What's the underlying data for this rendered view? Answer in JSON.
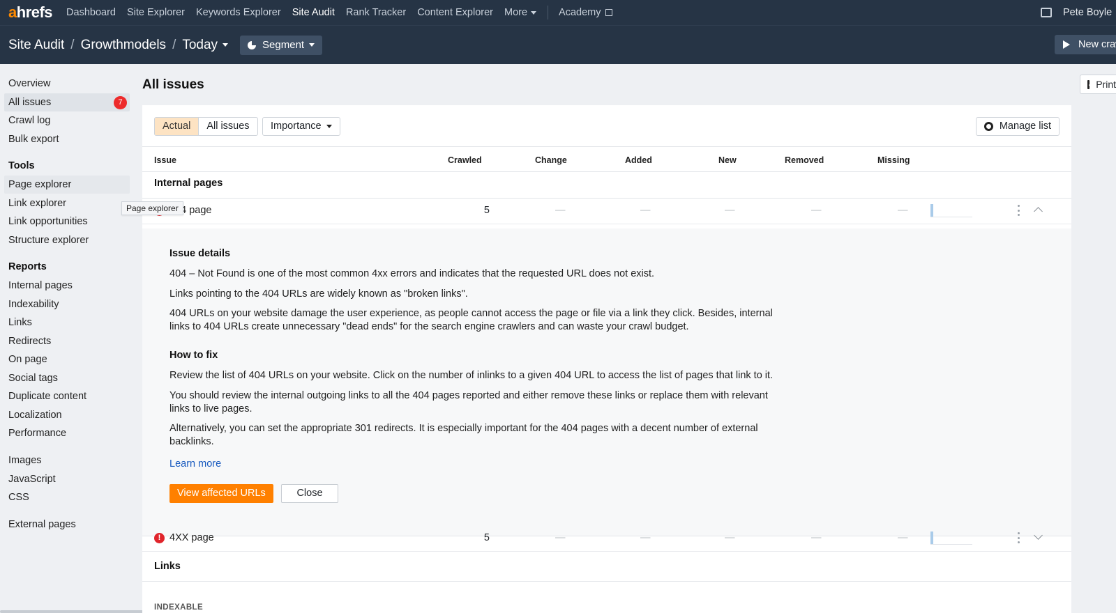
{
  "nav": {
    "logo_a": "a",
    "logo_rest": "hrefs",
    "links": [
      "Dashboard",
      "Site Explorer",
      "Keywords Explorer",
      "Site Audit",
      "Rank Tracker",
      "Content Explorer"
    ],
    "more": "More",
    "academy": "Academy",
    "user": "Pete Boyle"
  },
  "subheader": {
    "crumb1": "Site Audit",
    "crumb2": "Growthmodels",
    "crumb3": "Today",
    "segment": "Segment",
    "new_crawl": "New crawl"
  },
  "sidebar": {
    "items_top": [
      "Overview",
      "All issues",
      "Crawl log",
      "Bulk export"
    ],
    "all_issues_badge": "7",
    "tools_heading": "Tools",
    "tools": [
      "Page explorer",
      "Link explorer",
      "Link opportunities",
      "Structure explorer"
    ],
    "reports_heading": "Reports",
    "reports": [
      "Internal pages",
      "Indexability",
      "Links",
      "Redirects",
      "On page",
      "Social tags",
      "Duplicate content",
      "Localization",
      "Performance"
    ],
    "media": [
      "Images",
      "JavaScript",
      "CSS"
    ],
    "external": "External pages",
    "tooltip": "Page explorer"
  },
  "main": {
    "title": "All issues",
    "print": "Print",
    "filter_actual": "Actual",
    "filter_all": "All issues",
    "importance": "Importance",
    "manage_list": "Manage list",
    "columns": [
      "Issue",
      "Crawled",
      "Change",
      "Added",
      "New",
      "Removed",
      "Missing"
    ],
    "group_internal": "Internal pages",
    "group_links": "Links",
    "sub_indexable": "INDEXABLE",
    "rows": [
      {
        "name": "404 page",
        "crawled": "5",
        "dash": "—"
      },
      {
        "name": "4XX page",
        "crawled": "5",
        "dash": "—"
      }
    ],
    "details": {
      "heading1": "Issue details",
      "p1": "404 – Not Found is one of the most common 4xx errors and indicates that the requested URL does not exist.",
      "p2": "Links pointing to the 404 URLs are widely known as \"broken links\".",
      "p3": "404 URLs on your website damage the user experience, as people cannot access the page or file via a link they click. Besides, internal links to 404 URLs create unnecessary \"dead ends\" for the search engine crawlers and can waste your crawl budget.",
      "heading2": "How to fix",
      "p4": "Review the list of 404 URLs on your website. Click on the number of inlinks to a given 404 URL to access the list of pages that link to it.",
      "p5": "You should review the internal outgoing links to all the 404 pages reported and either remove these links or replace them with relevant links to live pages.",
      "p6": "Alternatively, you can set the appropriate 301 redirects. It is especially important for the 404 pages with a decent number of external backlinks.",
      "learn_more": "Learn more",
      "view_button": "View affected URLs",
      "close_button": "Close"
    }
  }
}
